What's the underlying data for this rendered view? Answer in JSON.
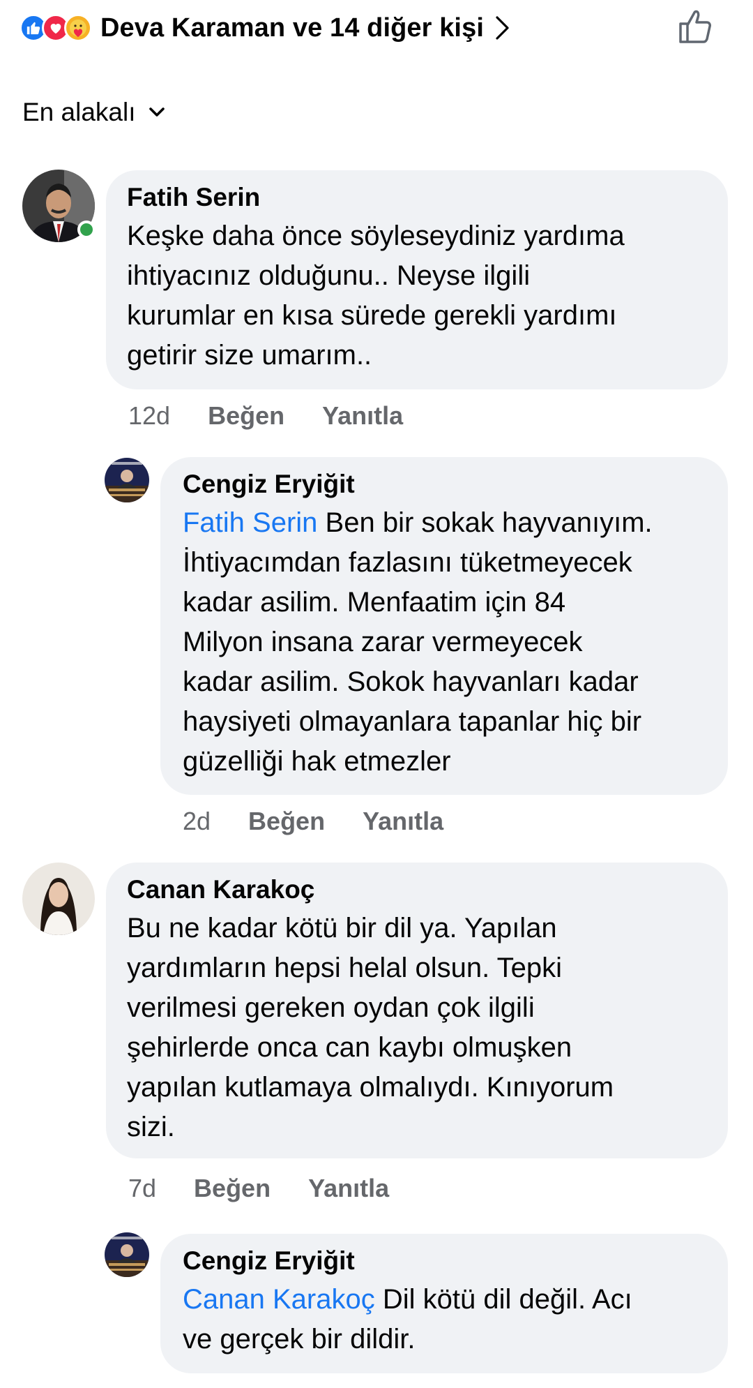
{
  "reactions": {
    "icons": [
      "like-reaction-icon",
      "love-reaction-icon",
      "care-reaction-icon"
    ],
    "summary": "Deva Karaman ve 14 diğer kişi"
  },
  "sort": {
    "label": "En alakalı"
  },
  "comments": [
    {
      "author": "Fatih Serin",
      "text": "Keşke daha önce söyleseydiniz yardıma\nihtiyacınız olduğunu.. Neyse ilgili\nkurumlar en kısa sürede gerekli yardımı\ngetirir size umarım..",
      "age": "12d",
      "like": "Beğen",
      "reply": "Yanıtla"
    },
    {
      "author": "Cengiz Eryiğit",
      "mention": "Fatih Serin",
      "text": " Ben bir sokak hayvanıyım.\nİhtiyacımdan fazlasını tüketmeyecek\nkadar asilim. Menfaatim için 84\nMilyon insana zarar vermeyecek\nkadar asilim. Sokok hayvanları kadar\nhaysiyeti olmayanlara tapanlar hiç bir\ngüzelliği hak etmezler",
      "age": "2d",
      "like": "Beğen",
      "reply": "Yanıtla"
    },
    {
      "author": "Canan Karakoç",
      "text": "Bu ne kadar kötü bir dil ya. Yapılan\nyardımların hepsi helal olsun. Tepki\nverilmesi gereken  oydan çok  ilgili\nşehirlerde onca can kaybı olmuşken\nyapılan kutlamaya olmalıydı. Kınıyorum\nsizi.",
      "age": "7d",
      "like": "Beğen",
      "reply": "Yanıtla"
    },
    {
      "author": "Cengiz Eryiğit",
      "mention": "Canan Karakoç",
      "text": " Dil kötü dil değil. Acı\nve gerçek bir dildir."
    }
  ],
  "colors": {
    "accent": "#1877f2",
    "bubble": "#f0f2f5",
    "meta_text": "#65676b",
    "online": "#31a24c"
  }
}
